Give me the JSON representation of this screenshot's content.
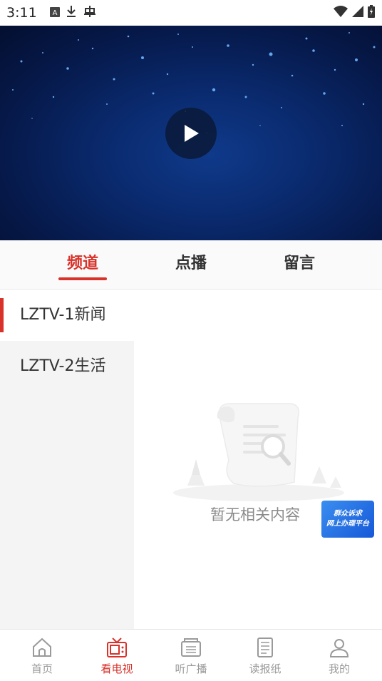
{
  "status_bar": {
    "time": "3:11",
    "icons_left": [
      "a-box-icon",
      "download-icon",
      "bug-icon"
    ],
    "icons_right": [
      "wifi-icon",
      "signal-icon",
      "battery-icon"
    ]
  },
  "player": {
    "play_icon": "play-icon"
  },
  "tabs": [
    {
      "label": "频道",
      "active": true
    },
    {
      "label": "点播",
      "active": false
    },
    {
      "label": "留言",
      "active": false
    }
  ],
  "channels": [
    {
      "label": "LZTV-1新闻",
      "selected": true
    },
    {
      "label": "LZTV-2生活",
      "selected": false
    }
  ],
  "content": {
    "empty_text": "暂无相关内容",
    "badge": {
      "line1": "群众诉求",
      "line2": "网上办理平台"
    }
  },
  "bottom_nav": [
    {
      "label": "首页",
      "icon": "home-icon",
      "active": false
    },
    {
      "label": "看电视",
      "icon": "tv-icon",
      "active": true
    },
    {
      "label": "听广播",
      "icon": "radio-icon",
      "active": false
    },
    {
      "label": "读报纸",
      "icon": "newspaper-icon",
      "active": false
    },
    {
      "label": "我的",
      "icon": "user-icon",
      "active": false
    }
  ],
  "colors": {
    "accent": "#d8322a",
    "inactive": "#9a9a9a",
    "badge": "#2a78e8"
  }
}
